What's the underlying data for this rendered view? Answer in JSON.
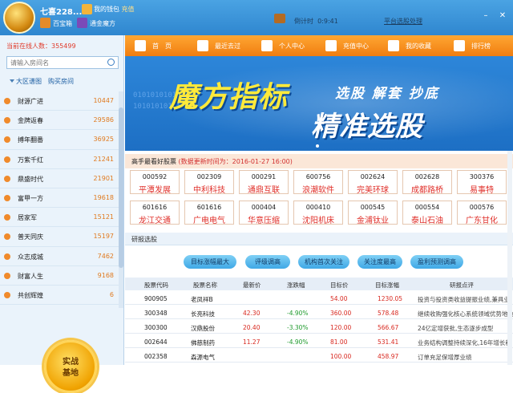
{
  "titlebar": {
    "username": "七喜228...",
    "wallet_label": "我的钱包",
    "wallet_action": "充值",
    "baibao_label": "百宝箱",
    "mofang_label": "通金魔方",
    "timer_label": "倒计时",
    "timer_value": "0:9:41",
    "platform_link": "平台选股处理",
    "min_icon": "minimize-icon",
    "close_icon": "close-icon"
  },
  "sidebar": {
    "online_label": "当前在线人数：",
    "online_count": "355499",
    "search_placeholder": "请输入房间名",
    "tabs": [
      "大区谱图",
      "购买房间"
    ],
    "rooms": [
      {
        "name": "财源广进",
        "count": "10447"
      },
      {
        "name": "金牌返春",
        "count": "29586"
      },
      {
        "name": "搏年翻番",
        "count": "36925"
      },
      {
        "name": "万紫千红",
        "count": "21241"
      },
      {
        "name": "鼎盛时代",
        "count": "21901"
      },
      {
        "name": "富甲一方",
        "count": "19618"
      },
      {
        "name": "居家军",
        "count": "15121"
      },
      {
        "name": "普天同庆",
        "count": "15197"
      },
      {
        "name": "众志成城",
        "count": "7462"
      },
      {
        "name": "财富人生",
        "count": "9168"
      },
      {
        "name": "共创辉煌",
        "count": "6"
      }
    ],
    "combat_line1": "实战",
    "combat_line2": "基地"
  },
  "nav": {
    "items": [
      "首　页",
      "最近去过",
      "个人中心",
      "充值中心",
      "我的收藏",
      "排行榜"
    ]
  },
  "banner": {
    "title": "魔方指标",
    "sub": "选股 解套 抄底",
    "main": "精准选股",
    "bits1": "01010101010101",
    "bits2": "1010101010101"
  },
  "hot": {
    "title_prefix": "高手最看好股票",
    "title_time": "(数据更新时间为：2016-01-27  16:00)",
    "stocks": [
      {
        "code": "000592",
        "name": "平潭发展"
      },
      {
        "code": "002309",
        "name": "中利科技"
      },
      {
        "code": "000291",
        "name": "通鼎互联"
      },
      {
        "code": "600756",
        "name": "浪潮软件"
      },
      {
        "code": "002624",
        "name": "完美环球"
      },
      {
        "code": "002628",
        "name": "成都路桥"
      },
      {
        "code": "300376",
        "name": "易事特"
      },
      {
        "code": "601616",
        "name": "龙江交通"
      },
      {
        "code": "601616",
        "name": "广电电气"
      },
      {
        "code": "000404",
        "name": "华意压缩"
      },
      {
        "code": "000410",
        "name": "沈阳机床"
      },
      {
        "code": "000545",
        "name": "金浦钛业"
      },
      {
        "code": "000554",
        "name": "泰山石油"
      },
      {
        "code": "000576",
        "name": "广东甘化"
      }
    ]
  },
  "research": {
    "title": "研报选股",
    "filters": [
      "目标涨幅最大",
      "评级调高",
      "机构首次关注",
      "关注度最高",
      "盈利预测调高"
    ],
    "columns": [
      "股票代码",
      "股票名称",
      "最新价",
      "涨跌幅",
      "目标价",
      "目标涨幅",
      "研报点评"
    ],
    "rows": [
      {
        "code": "900905",
        "name": "老凤祥B",
        "price": "",
        "change": "",
        "target": "54.00",
        "upside": "1230.05",
        "comment": "投资与投资类收益提振业绩,兼具业"
      },
      {
        "code": "300348",
        "name": "长亮科技",
        "price": "42.30",
        "change": "-4.90%",
        "target": "360.00",
        "upside": "578.48",
        "comment": "继续收购强化核心系统领域优势地位"
      },
      {
        "code": "300300",
        "name": "汉鼎股份",
        "price": "20.40",
        "change": "-3.30%",
        "target": "120.00",
        "upside": "566.67",
        "comment": "24亿定增获批,生态逐步成型"
      },
      {
        "code": "002644",
        "name": "佛慈制药",
        "price": "11.27",
        "change": "-4.90%",
        "target": "81.00",
        "upside": "531.41",
        "comment": "业务结构调整持续深化,16年增长稳"
      },
      {
        "code": "002358",
        "name": "森源电气",
        "price": "",
        "change": "",
        "target": "100.00",
        "upside": "458.97",
        "comment": "订单充足保增厚业绩"
      }
    ]
  },
  "colors": {
    "accent_orange": "#f07d10",
    "brand_blue": "#2f86cf",
    "up_red": "#d8281f",
    "down_green": "#1f9a2d"
  }
}
